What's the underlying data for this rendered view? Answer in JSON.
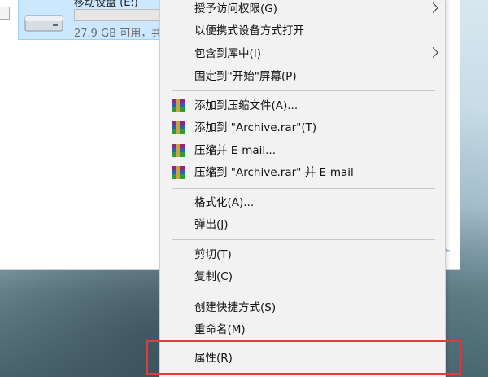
{
  "drive": {
    "name": "移动设盘 (E:)",
    "free_text": "27.9 GB 可用，共",
    "used_fraction": 0,
    "icon": "usb-drive-icon"
  },
  "menu": {
    "grant_access": "授予访问权限(G)",
    "portable_open": "以便携式设备方式打开",
    "include_library": "包含到库中(I)",
    "pin_start": "固定到\"开始\"屏幕(P)",
    "add_archive": "添加到压缩文件(A)...",
    "add_archive_rar": "添加到 \"Archive.rar\"(T)",
    "compress_email": "压缩并 E-mail...",
    "compress_rar_email": "压缩到 \"Archive.rar\" 并 E-mail",
    "format": "格式化(A)...",
    "eject": "弹出(J)",
    "cut": "剪切(T)",
    "copy": "复制(C)",
    "create_shortcut": "创建快捷方式(S)",
    "rename": "重命名(M)",
    "properties": "属性(R)",
    "winrar_icon": "winrar-icon",
    "submenu_icon": "chevron-right-icon"
  },
  "colors": {
    "highlight_box": "#e23b3b",
    "menu_bg": "#f2f2f2",
    "selection": "#cce8ff"
  }
}
